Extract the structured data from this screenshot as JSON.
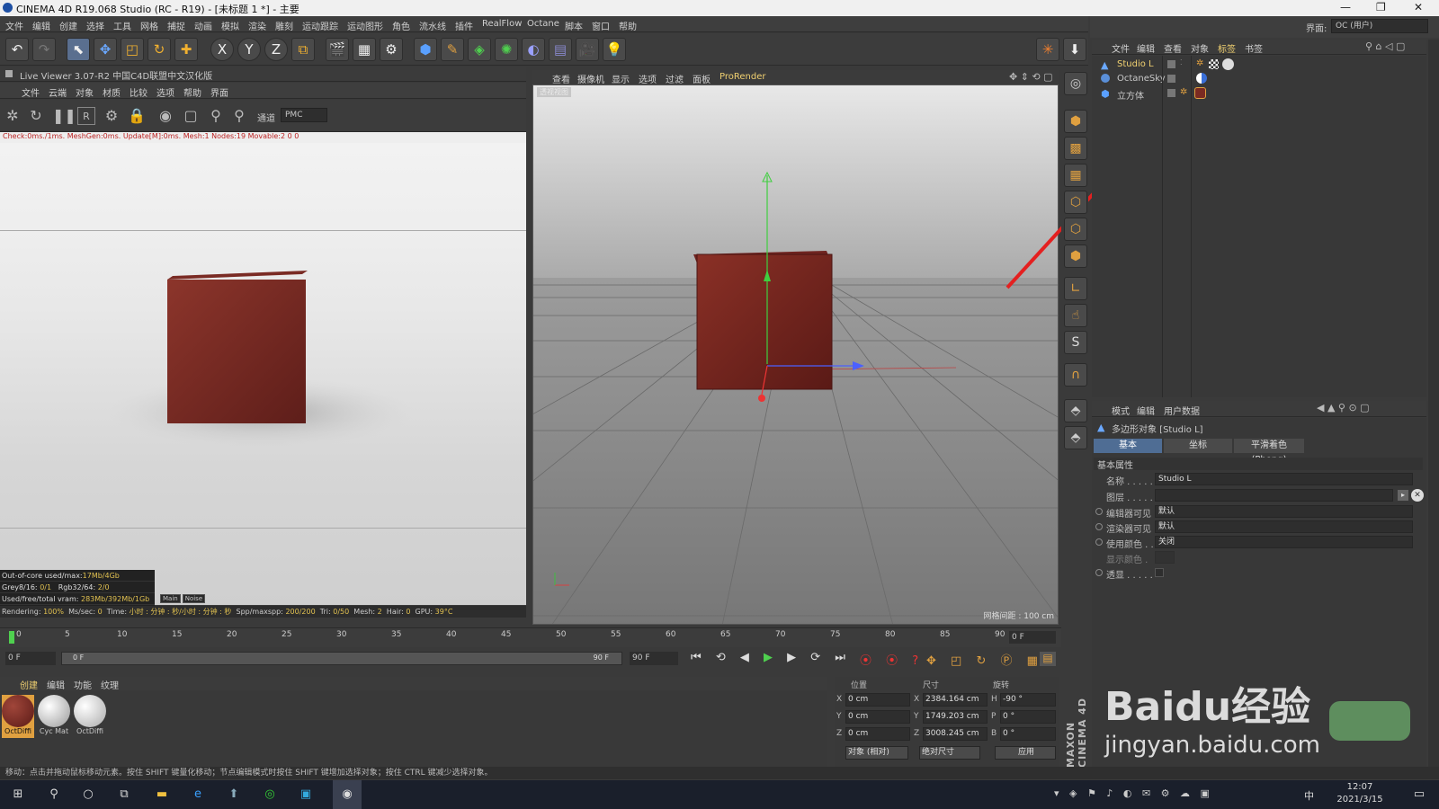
{
  "window": {
    "title": "CINEMA 4D R19.068 Studio (RC - R19) - [未标题 1 *] - 主要"
  },
  "menubar": [
    "文件",
    "编辑",
    "创建",
    "选择",
    "工具",
    "网格",
    "捕捉",
    "动画",
    "模拟",
    "渲染",
    "雕刻",
    "运动跟踪",
    "运动图形",
    "角色",
    "流水线",
    "插件",
    "RealFlow",
    "Octane",
    "脚本",
    "窗口",
    "帮助"
  ],
  "interface": {
    "label": "界面:",
    "value": "OC (用户)"
  },
  "live_viewer": {
    "title": "Live Viewer 3.07-R2 中国C4D联盟中文汉化版",
    "menu": [
      "文件",
      "云端",
      "对象",
      "材质",
      "比较",
      "选项",
      "帮助",
      "界面"
    ],
    "channel_label": "通道",
    "channel_value": "PMC",
    "status": "Check:0ms./1ms. MeshGen:0ms. Update[M]:0ms. Mesh:1 Nodes:19 Movable:2  0 0",
    "info": {
      "ooc_label": "Out-of-core used/max:",
      "ooc_value": "17Mb/4Gb",
      "grey_label": "Grey8/16:",
      "grey_value": "0/1",
      "rgb_label": "Rgb32/64:",
      "rgb_value": "2/0",
      "vram_label": "Used/free/total vram:",
      "vram_value": "283Mb/392Mb/1Gb"
    },
    "tags": [
      "Main",
      "Noise"
    ],
    "render_bar": {
      "rendering_label": "Rendering:",
      "rendering_value": "100%",
      "ms_label": "Ms/sec:",
      "ms_value": "0",
      "time_label": "Time:",
      "time_value": "小时 : 分钟 : 秒/小时 : 分钟 : 秒",
      "spp_label": "Spp/maxspp:",
      "spp_value": "200/200",
      "tri_label": "Tri:",
      "tri_value": "0/50",
      "mesh_label": "Mesh:",
      "mesh_value": "2",
      "hair_label": "Hair:",
      "hair_value": "0",
      "gpu_label": "GPU:",
      "gpu_value": "39°C"
    }
  },
  "viewport": {
    "menu": [
      "查看",
      "摄像机",
      "显示",
      "选项",
      "过滤",
      "面板",
      "ProRender"
    ],
    "camera_label": "透视视图",
    "grid_spacing": "网格间距 : 100 cm"
  },
  "objects": {
    "menu": [
      "文件",
      "编辑",
      "查看",
      "对象",
      "标签",
      "书签"
    ],
    "rows": [
      {
        "name": "Studio L",
        "icon": "light-icon",
        "selected": true
      },
      {
        "name": "OctaneSky",
        "icon": "sky-icon",
        "selected": false
      },
      {
        "name": "立方体",
        "icon": "cube-icon",
        "selected": false
      }
    ]
  },
  "attributes": {
    "menu": [
      "模式",
      "编辑",
      "用户数据"
    ],
    "object_title": "多边形对象 [Studio L]",
    "tabs": [
      "基本",
      "坐标",
      "平滑着色(Phong)"
    ],
    "section": "基本属性",
    "fields": [
      {
        "label": "名称 . . . . .",
        "value": "Studio L"
      },
      {
        "label": "图层 . . . . .",
        "value": ""
      },
      {
        "label": "编辑器可见",
        "value": "默认"
      },
      {
        "label": "渲染器可见",
        "value": "默认"
      },
      {
        "label": "使用颜色 . .",
        "value": "关闭"
      },
      {
        "label": "显示颜色 .",
        "value": ""
      },
      {
        "label": "透显 . . . . .",
        "value": ""
      }
    ]
  },
  "timeline": {
    "ticks": [
      "0",
      "5",
      "10",
      "15",
      "20",
      "25",
      "30",
      "35",
      "40",
      "45",
      "50",
      "55",
      "60",
      "65",
      "70",
      "75",
      "80",
      "85",
      "90"
    ],
    "current": "0 F",
    "start": "0 F",
    "range_start": "0 F",
    "range_end": "90 F",
    "end": "90 F"
  },
  "materials": {
    "menu": [
      "创建",
      "编辑",
      "功能",
      "纹理"
    ],
    "items": [
      {
        "name": "OctDiffi",
        "color": "#7a2a22"
      },
      {
        "name": "Cyc Mat",
        "color": "#d8d8d8"
      },
      {
        "name": "OctDiffi",
        "color": "#e6e6e6"
      }
    ]
  },
  "coords": {
    "headers": [
      "位置",
      "尺寸",
      "旋转"
    ],
    "rows": [
      {
        "axis": "X",
        "pos": "0 cm",
        "size_axis": "X",
        "size": "2384.164 cm",
        "rot_axis": "H",
        "rot": "-90 °"
      },
      {
        "axis": "Y",
        "pos": "0 cm",
        "size_axis": "Y",
        "size": "1749.203 cm",
        "rot_axis": "P",
        "rot": "0 °"
      },
      {
        "axis": "Z",
        "pos": "0 cm",
        "size_axis": "Z",
        "size": "3008.245 cm",
        "rot_axis": "B",
        "rot": "0 °"
      }
    ],
    "mode1": "对象 (相对)",
    "mode2": "绝对尺寸",
    "apply": "应用"
  },
  "statusbar": "移动：点击并拖动鼠标移动元素。按住 SHIFT 键量化移动；节点编辑模式时按住 SHIFT 键增加选择对象；按住 CTRL 键减少选择对象。",
  "branding": "MAXON CINEMA 4D",
  "taskbar": {
    "time": "12:07",
    "date": "2021/3/15",
    "ime": "中"
  },
  "watermark": {
    "text": "Baidu经验",
    "url": "jingyan.baidu.com"
  }
}
